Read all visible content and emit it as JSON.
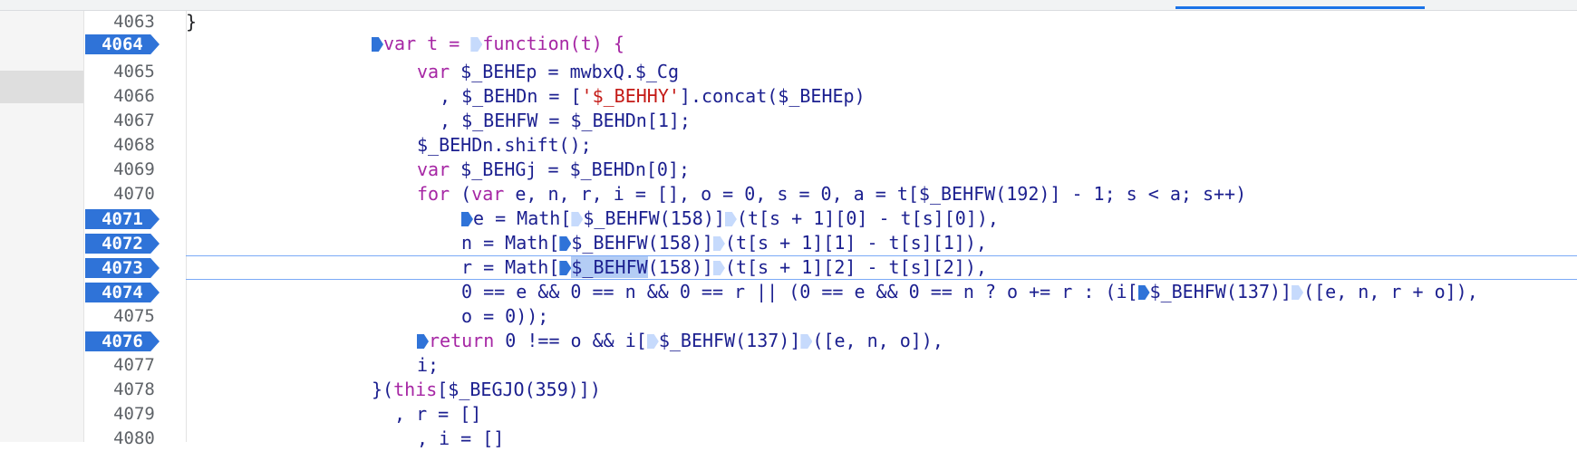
{
  "editor": {
    "lines": [
      {
        "num": "4063",
        "bp": false
      },
      {
        "num": "4064",
        "bp": true
      },
      {
        "num": "4065",
        "bp": false
      },
      {
        "num": "4066",
        "bp": false
      },
      {
        "num": "4067",
        "bp": false
      },
      {
        "num": "4068",
        "bp": false
      },
      {
        "num": "4069",
        "bp": false
      },
      {
        "num": "4070",
        "bp": false
      },
      {
        "num": "4071",
        "bp": true
      },
      {
        "num": "4072",
        "bp": true
      },
      {
        "num": "4073",
        "bp": true
      },
      {
        "num": "4074",
        "bp": true
      },
      {
        "num": "4075",
        "bp": false
      },
      {
        "num": "4076",
        "bp": true
      },
      {
        "num": "4077",
        "bp": false
      },
      {
        "num": "4078",
        "bp": false
      },
      {
        "num": "4079",
        "bp": false
      },
      {
        "num": "4080",
        "bp": false
      }
    ],
    "code": {
      "l4063": "}",
      "l4064_a": "var t = ",
      "l4064_b": "function(t) {",
      "l4065_kw": "var",
      "l4065": " $_BEHEp = mwbxQ.$_Cg",
      "l4066_a": ", $_BEHDn = [",
      "l4066_str": "'$_BEHHY'",
      "l4066_b": "].concat($_BEHEp)",
      "l4067": ", $_BEHFW = $_BEHDn[1];",
      "l4068": "$_BEHDn.shift();",
      "l4069_kw": "var",
      "l4069": " $_BEHGj = $_BEHDn[0];",
      "l4070_kw1": "for",
      "l4070_a": " (",
      "l4070_kw2": "var",
      "l4070_b": " e, n, r, i = [], o = 0, s = 0, a = t[$_BEHFW(192)] - 1; s < a; s++)",
      "l4071_a": "e = Math[",
      "l4071_b": "$_BEHFW(158)]",
      "l4071_c": "(t[s + 1][0] - t[s][0]),",
      "l4072_a": "n = Math[",
      "l4072_b": "$_BEHFW(158)]",
      "l4072_c": "(t[s + 1][1] - t[s][1]),",
      "l4073_a": "r = Math[",
      "l4073_sel": "$_BEHFW",
      "l4073_b": "(158)]",
      "l4073_c": "(t[s + 1][2] - t[s][2]),",
      "l4074_a": "0 == e && 0 == n && 0 == r || (0 == e && 0 == n ? o += r : (i[",
      "l4074_b": "$_BEHFW(137)]",
      "l4074_c": "([e, n, r + o]),",
      "l4075": "o = 0));",
      "l4076_kw": "return",
      "l4076_a": " 0 !== o && i[",
      "l4076_b": "$_BEHFW(137)]",
      "l4076_c": "([e, n, o]),",
      "l4077": "i;",
      "l4078_a": "}(",
      "l4078_kw": "this",
      "l4078_b": "[$_BEGJO(359)])",
      "l4079": ", r = []",
      "l4080": ", i = []"
    }
  },
  "colors": {
    "breakpoint": "#2f73d8",
    "keyword": "#a626a4",
    "string": "#c41a16",
    "selection": "#b4cdf5",
    "current_line_border": "#7baaf7"
  }
}
